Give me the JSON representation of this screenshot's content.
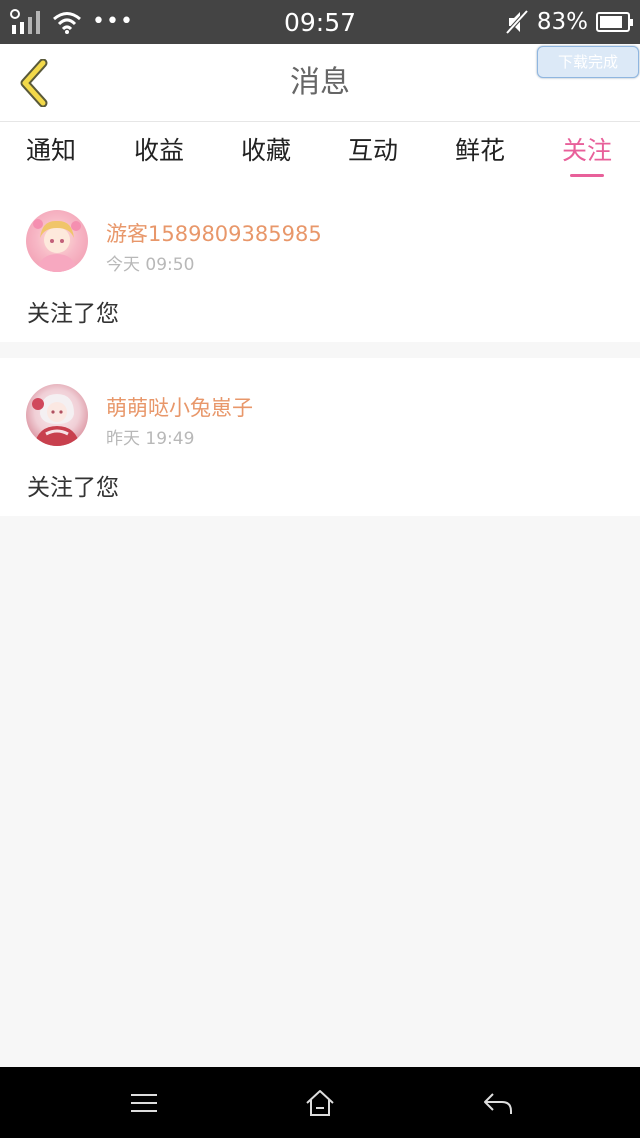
{
  "status_bar": {
    "time": "09:57",
    "battery_text": "83%",
    "battery_level": 0.83,
    "icons": [
      "signal-icon",
      "wifi-icon",
      "more-dots-icon",
      "mute-icon",
      "battery-icon"
    ]
  },
  "header": {
    "title": "消息",
    "back_icon": "chevron-left-icon",
    "download_badge": "下载完成"
  },
  "tabs": [
    {
      "label": "通知",
      "active": false
    },
    {
      "label": "收益",
      "active": false
    },
    {
      "label": "收藏",
      "active": false
    },
    {
      "label": "互动",
      "active": false
    },
    {
      "label": "鲜花",
      "active": false
    },
    {
      "label": "关注",
      "active": true
    }
  ],
  "colors": {
    "accent": "#e8609a",
    "username": "#e8976a",
    "background": "#f7f7f7"
  },
  "messages": [
    {
      "username": "游客1589809385985",
      "time": "今天 09:50",
      "text": "关注了您"
    },
    {
      "username": "萌萌哒小兔崽子",
      "time": "昨天 19:49",
      "text": "关注了您"
    }
  ],
  "nav": {
    "icons": [
      "menu-icon",
      "home-icon",
      "back-arrow-icon"
    ]
  }
}
